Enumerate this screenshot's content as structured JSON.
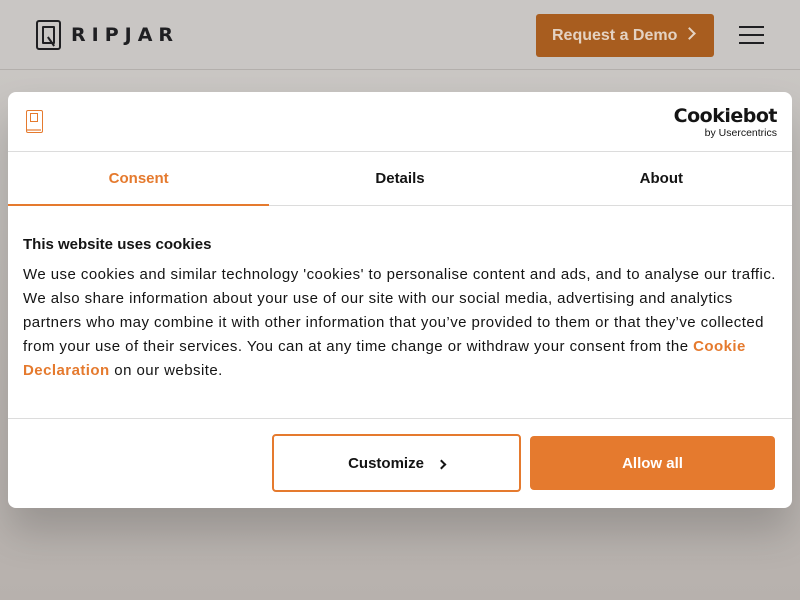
{
  "site": {
    "logo_text": "RIPJAR",
    "demo_button_label": "Request a Demo"
  },
  "cookie_dialog": {
    "provider_name": "Cookiebot",
    "provider_sub": "by Usercentrics",
    "tabs": [
      {
        "label": "Consent",
        "active": true
      },
      {
        "label": "Details",
        "active": false
      },
      {
        "label": "About",
        "active": false
      }
    ],
    "heading": "This website uses cookies",
    "body_text": "We use cookies and similar technology 'cookies' to personalise content and ads, and to analyse our traffic. We also share information about your use of our site with our social media, advertising and analytics partners who may combine it with other information that you’ve provided to them or that they’ve collected from your use of their services. You can at any time change or withdraw your consent from the",
    "link_text": "Cookie Declaration",
    "body_suffix": "on our website.",
    "customize_label": "Customize",
    "allow_all_label": "Allow all"
  },
  "colors": {
    "accent": "#e57a2e",
    "text": "#141414",
    "overlay_header_button": "#a85d1f"
  },
  "icons": {
    "demo_chevron": "chevron-right-icon",
    "menu": "hamburger-menu-icon",
    "customize_chevron": "chevron-right-icon"
  }
}
